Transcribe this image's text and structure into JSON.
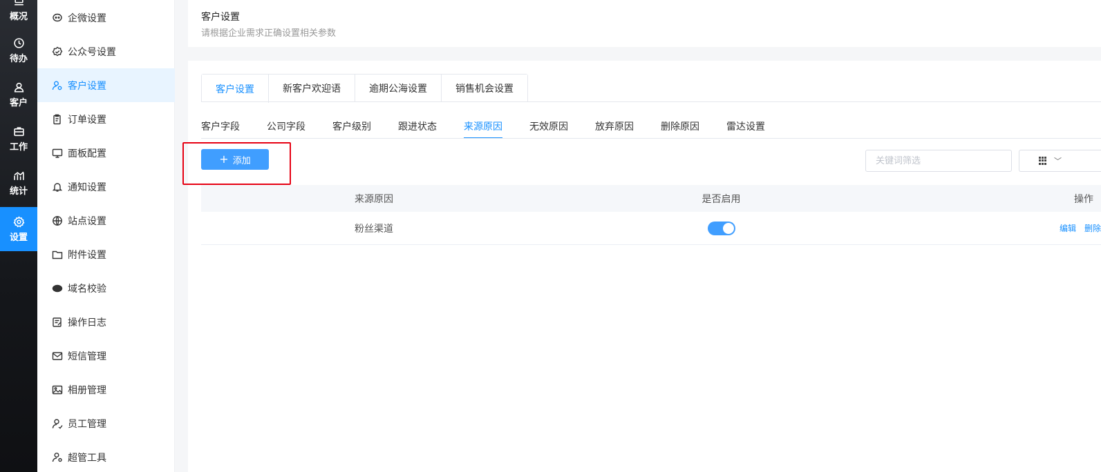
{
  "rail": {
    "items": [
      {
        "label": "概况",
        "icon": "overview-icon"
      },
      {
        "label": "待办",
        "icon": "clock-icon"
      },
      {
        "label": "客户",
        "icon": "user-icon"
      },
      {
        "label": "工作",
        "icon": "briefcase-icon"
      },
      {
        "label": "统计",
        "icon": "chart-icon"
      },
      {
        "label": "设置",
        "icon": "gear-icon",
        "active": true
      }
    ]
  },
  "submenu": {
    "items": [
      {
        "label": "企微设置",
        "icon": "wecom-icon"
      },
      {
        "label": "公众号设置",
        "icon": "badge-icon"
      },
      {
        "label": "客户设置",
        "icon": "user-gear-icon",
        "active": true
      },
      {
        "label": "订单设置",
        "icon": "clipboard-icon"
      },
      {
        "label": "面板配置",
        "icon": "monitor-icon"
      },
      {
        "label": "通知设置",
        "icon": "bell-icon"
      },
      {
        "label": "站点设置",
        "icon": "globe-icon"
      },
      {
        "label": "附件设置",
        "icon": "folder-icon"
      },
      {
        "label": "域名校验",
        "icon": "www-icon"
      },
      {
        "label": "操作日志",
        "icon": "log-icon"
      },
      {
        "label": "短信管理",
        "icon": "mail-icon"
      },
      {
        "label": "相册管理",
        "icon": "image-icon"
      },
      {
        "label": "员工管理",
        "icon": "staff-icon"
      },
      {
        "label": "超管工具",
        "icon": "admin-icon"
      }
    ]
  },
  "header": {
    "title": "客户设置",
    "subtitle": "请根据企业需求正确设置相关参数"
  },
  "tabs": [
    "客户设置",
    "新客户欢迎语",
    "逾期公海设置",
    "销售机会设置"
  ],
  "subtabs": [
    "客户字段",
    "公司字段",
    "客户级别",
    "跟进状态",
    "来源原因",
    "无效原因",
    "放弃原因",
    "删除原因",
    "雷达设置"
  ],
  "toolbar": {
    "add_label": "添加",
    "search_placeholder": "关键词筛选"
  },
  "table": {
    "columns": [
      "来源原因",
      "是否启用",
      "操作"
    ],
    "rows": [
      {
        "reason": "粉丝渠道",
        "enabled": true,
        "edit": "编辑",
        "delete": "删除"
      }
    ]
  },
  "colors": {
    "accent": "#1890ff",
    "highlight": "#e60012"
  }
}
